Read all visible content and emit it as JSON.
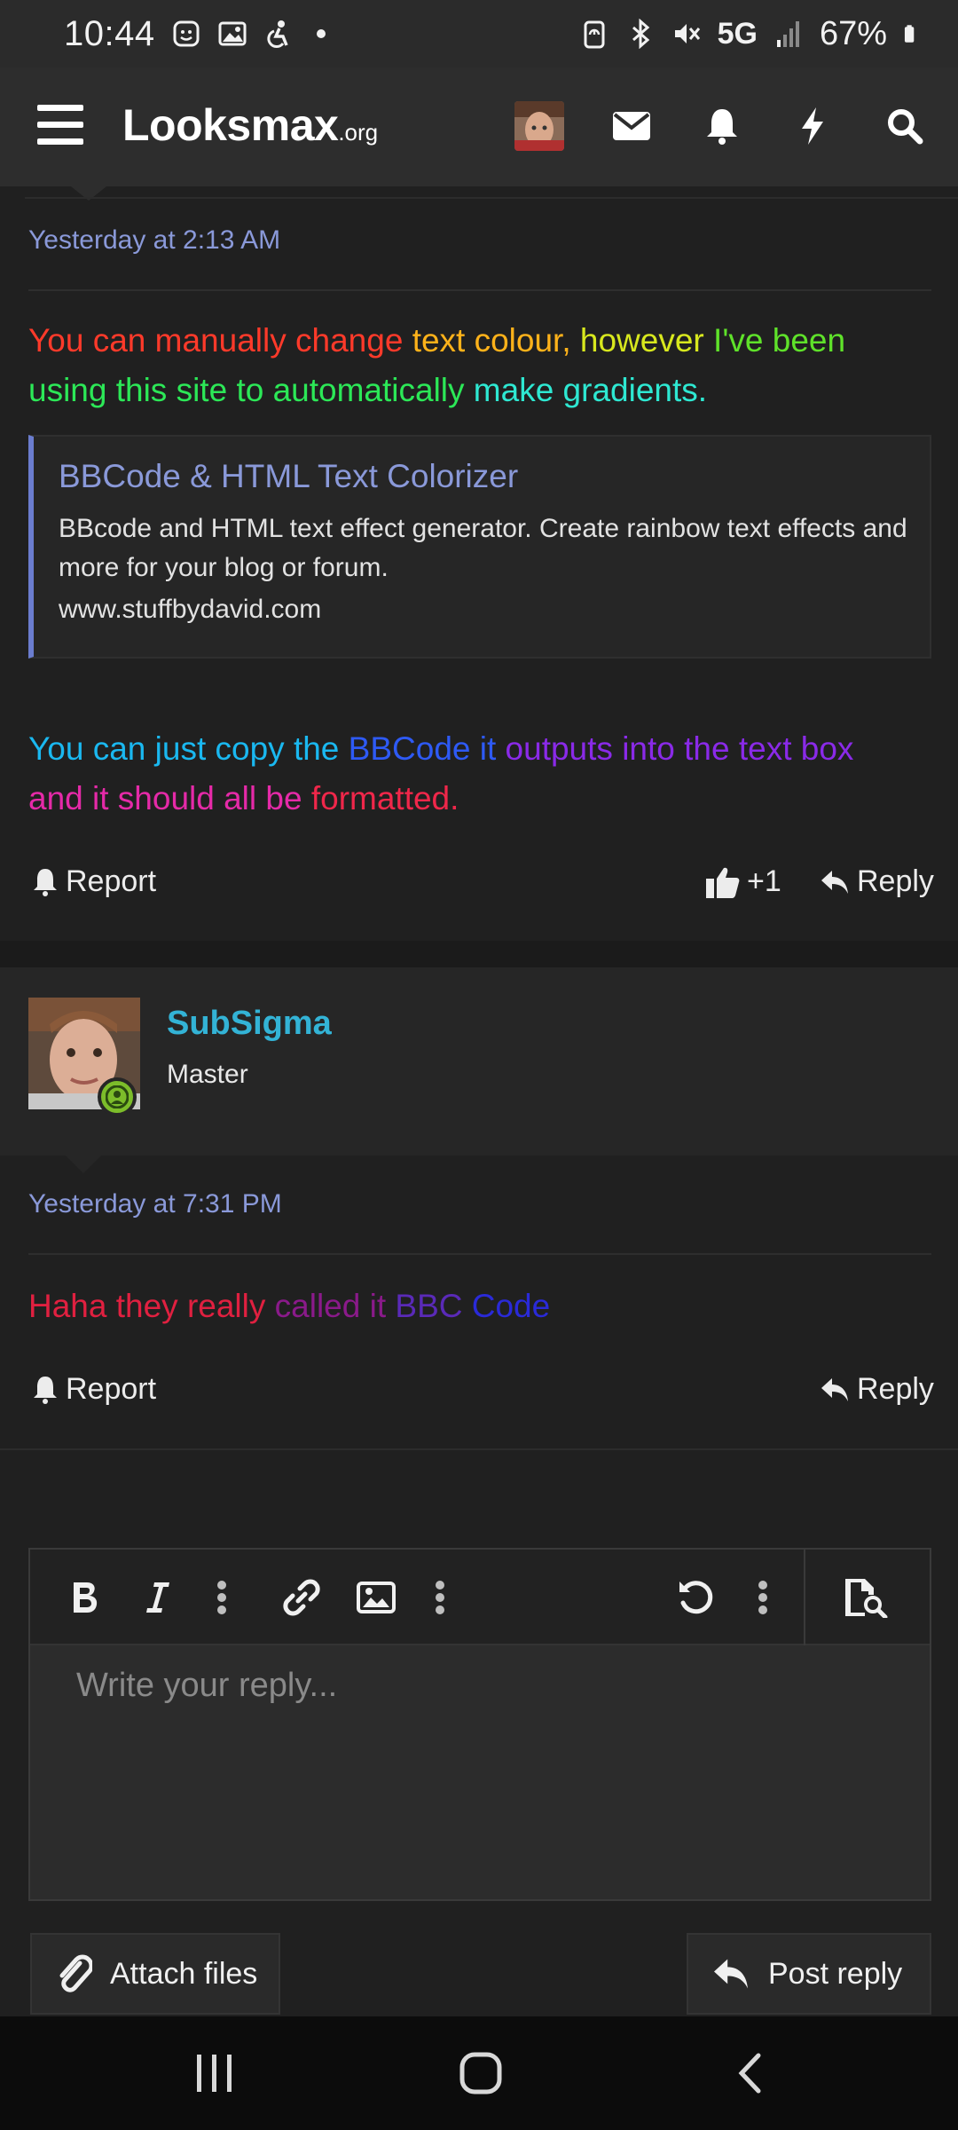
{
  "status_bar": {
    "time": "10:44",
    "network": "5G",
    "battery": "67%"
  },
  "header": {
    "logo_main": "Looksmax",
    "logo_tld": ".org"
  },
  "post1": {
    "date": "Yesterday at 2:13 AM",
    "paragraph1": [
      {
        "text": "You can manually change ",
        "color": "#ff3a2a"
      },
      {
        "text": "text colour, ",
        "color": "#ffb21a"
      },
      {
        "text": "however ",
        "color": "#d8e81e"
      },
      {
        "text": "I've been",
        "color": "#5fe22a"
      },
      {
        "text": "using this site to automatically ",
        "color": "#2ce857"
      },
      {
        "text": "make gradients.",
        "color": "#2ee8d2"
      }
    ],
    "preview": {
      "title": "BBCode & HTML Text Colorizer",
      "description": "BBcode and HTML text effect generator. Create rainbow text effects and more for your blog or forum.",
      "host": "www.stuffbydavid.com"
    },
    "paragraph2": [
      {
        "text": "You can just copy the ",
        "color": "#1ab8f0"
      },
      {
        "text": "BBCode it ",
        "color": "#2e5af5"
      },
      {
        "text": "outputs into the text box",
        "color": "#8a2ae8"
      },
      {
        "text": "and it should all be ",
        "color": "#e52aa8"
      },
      {
        "text": "formatted.",
        "color": "#f0274a"
      }
    ],
    "report_label": "Report",
    "reaction_label": "+1",
    "reply_label": "Reply"
  },
  "post2": {
    "author": "SubSigma",
    "author_title": "Master",
    "date": "Yesterday at 7:31 PM",
    "text": [
      {
        "text": "Haha they really ",
        "color": "#e02040"
      },
      {
        "text": "called it ",
        "color": "#8a1a8a"
      },
      {
        "text": "BBC ",
        "color": "#5a2ab8"
      },
      {
        "text": "Code",
        "color": "#2a2ad8"
      }
    ],
    "report_label": "Report",
    "reply_label": "Reply"
  },
  "editor": {
    "placeholder": "Write your reply...",
    "attach_label": "Attach files",
    "post_label": "Post reply"
  },
  "colors": {
    "accent": "#8a99d9",
    "username": "#33b3d6",
    "online": "#7cbd2a"
  },
  "icons": [
    "menu-icon",
    "mail-icon",
    "bell-icon",
    "bolt-icon",
    "search-icon",
    "thumbs-up-icon",
    "reply-icon",
    "bold-icon",
    "italic-icon",
    "more-icon",
    "link-icon",
    "image-icon",
    "undo-icon",
    "preview-icon",
    "paperclip-icon",
    "user-icon"
  ]
}
